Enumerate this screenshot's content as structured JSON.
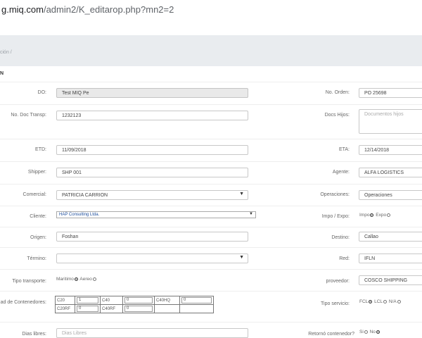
{
  "browser": {
    "url_host": "g.miq.com",
    "url_path": "/admin2/K_editarop.php?mn2=2"
  },
  "breadcrumb": "ción /",
  "section_title": "N",
  "form": {
    "do_label": "DO:",
    "do_value": "Test MIQ Pe",
    "order_label": "No. Orden:",
    "order_value": "PO 25698",
    "doc_transp_label": "No. Doc Transp:",
    "doc_transp_value": "1232123",
    "docs_hijos_label": "Docs Hijos:",
    "docs_hijos_placeholder": "Documentos hijos",
    "etd_label": "ETD:",
    "etd_value": "11/09/2018",
    "eta_label": "ETA:",
    "eta_value": "12/14/2018",
    "shipper_label": "Shipper:",
    "shipper_value": "SHP 001",
    "agente_label": "Agente:",
    "agente_value": "ALFA LOGISTICS",
    "comercial_label": "Comercial:",
    "comercial_value": "PATRICIA CARRION",
    "operaciones_label": "Operaciones:",
    "operaciones_value": "Operaciones",
    "cliente_label": "Cliente:",
    "cliente_value": "HAP Consulting Ltda.",
    "impo_expo_label": "Impo / Expo:",
    "impo_option": "Impo",
    "expo_option": "Expo",
    "origen_label": "Origen:",
    "origen_value": "Foshan",
    "destino_label": "Destino:",
    "destino_value": "Callao",
    "termino_label": "Término:",
    "termino_value": "",
    "red_label": "Red:",
    "red_value": "IFLN",
    "tipo_transporte_label": "Tipo transporte:",
    "maritimo_option": "Maritimo",
    "aereo_option": "Aereo",
    "proveedor_label": "proveedor:",
    "proveedor_value": "COSCO SHIPPING",
    "contenedores_label": "ad de Contenedores:",
    "tipo_servicio_label": "Tipo servicio:",
    "fcl_option": "FCL",
    "lcl_option": "LCL",
    "na_option": "N/A",
    "dias_libres_label": "Dias libres:",
    "dias_libres_placeholder": "Dias Libres",
    "retorno_label": "Retornó contenedor?",
    "si_option": "Si",
    "no_option": "No"
  },
  "containers": {
    "row1": [
      {
        "label": "C20",
        "value": "1"
      },
      {
        "label": "C40",
        "value": "0"
      },
      {
        "label": "C40HQ",
        "value": "0"
      }
    ],
    "row2": [
      {
        "label": "C20RF",
        "value": "0"
      },
      {
        "label": "C40RF",
        "value": "0"
      }
    ]
  },
  "selected": {
    "impo_expo": "Impo",
    "tipo_transporte": "Maritimo",
    "tipo_servicio": "FCL",
    "retorno": "No"
  }
}
